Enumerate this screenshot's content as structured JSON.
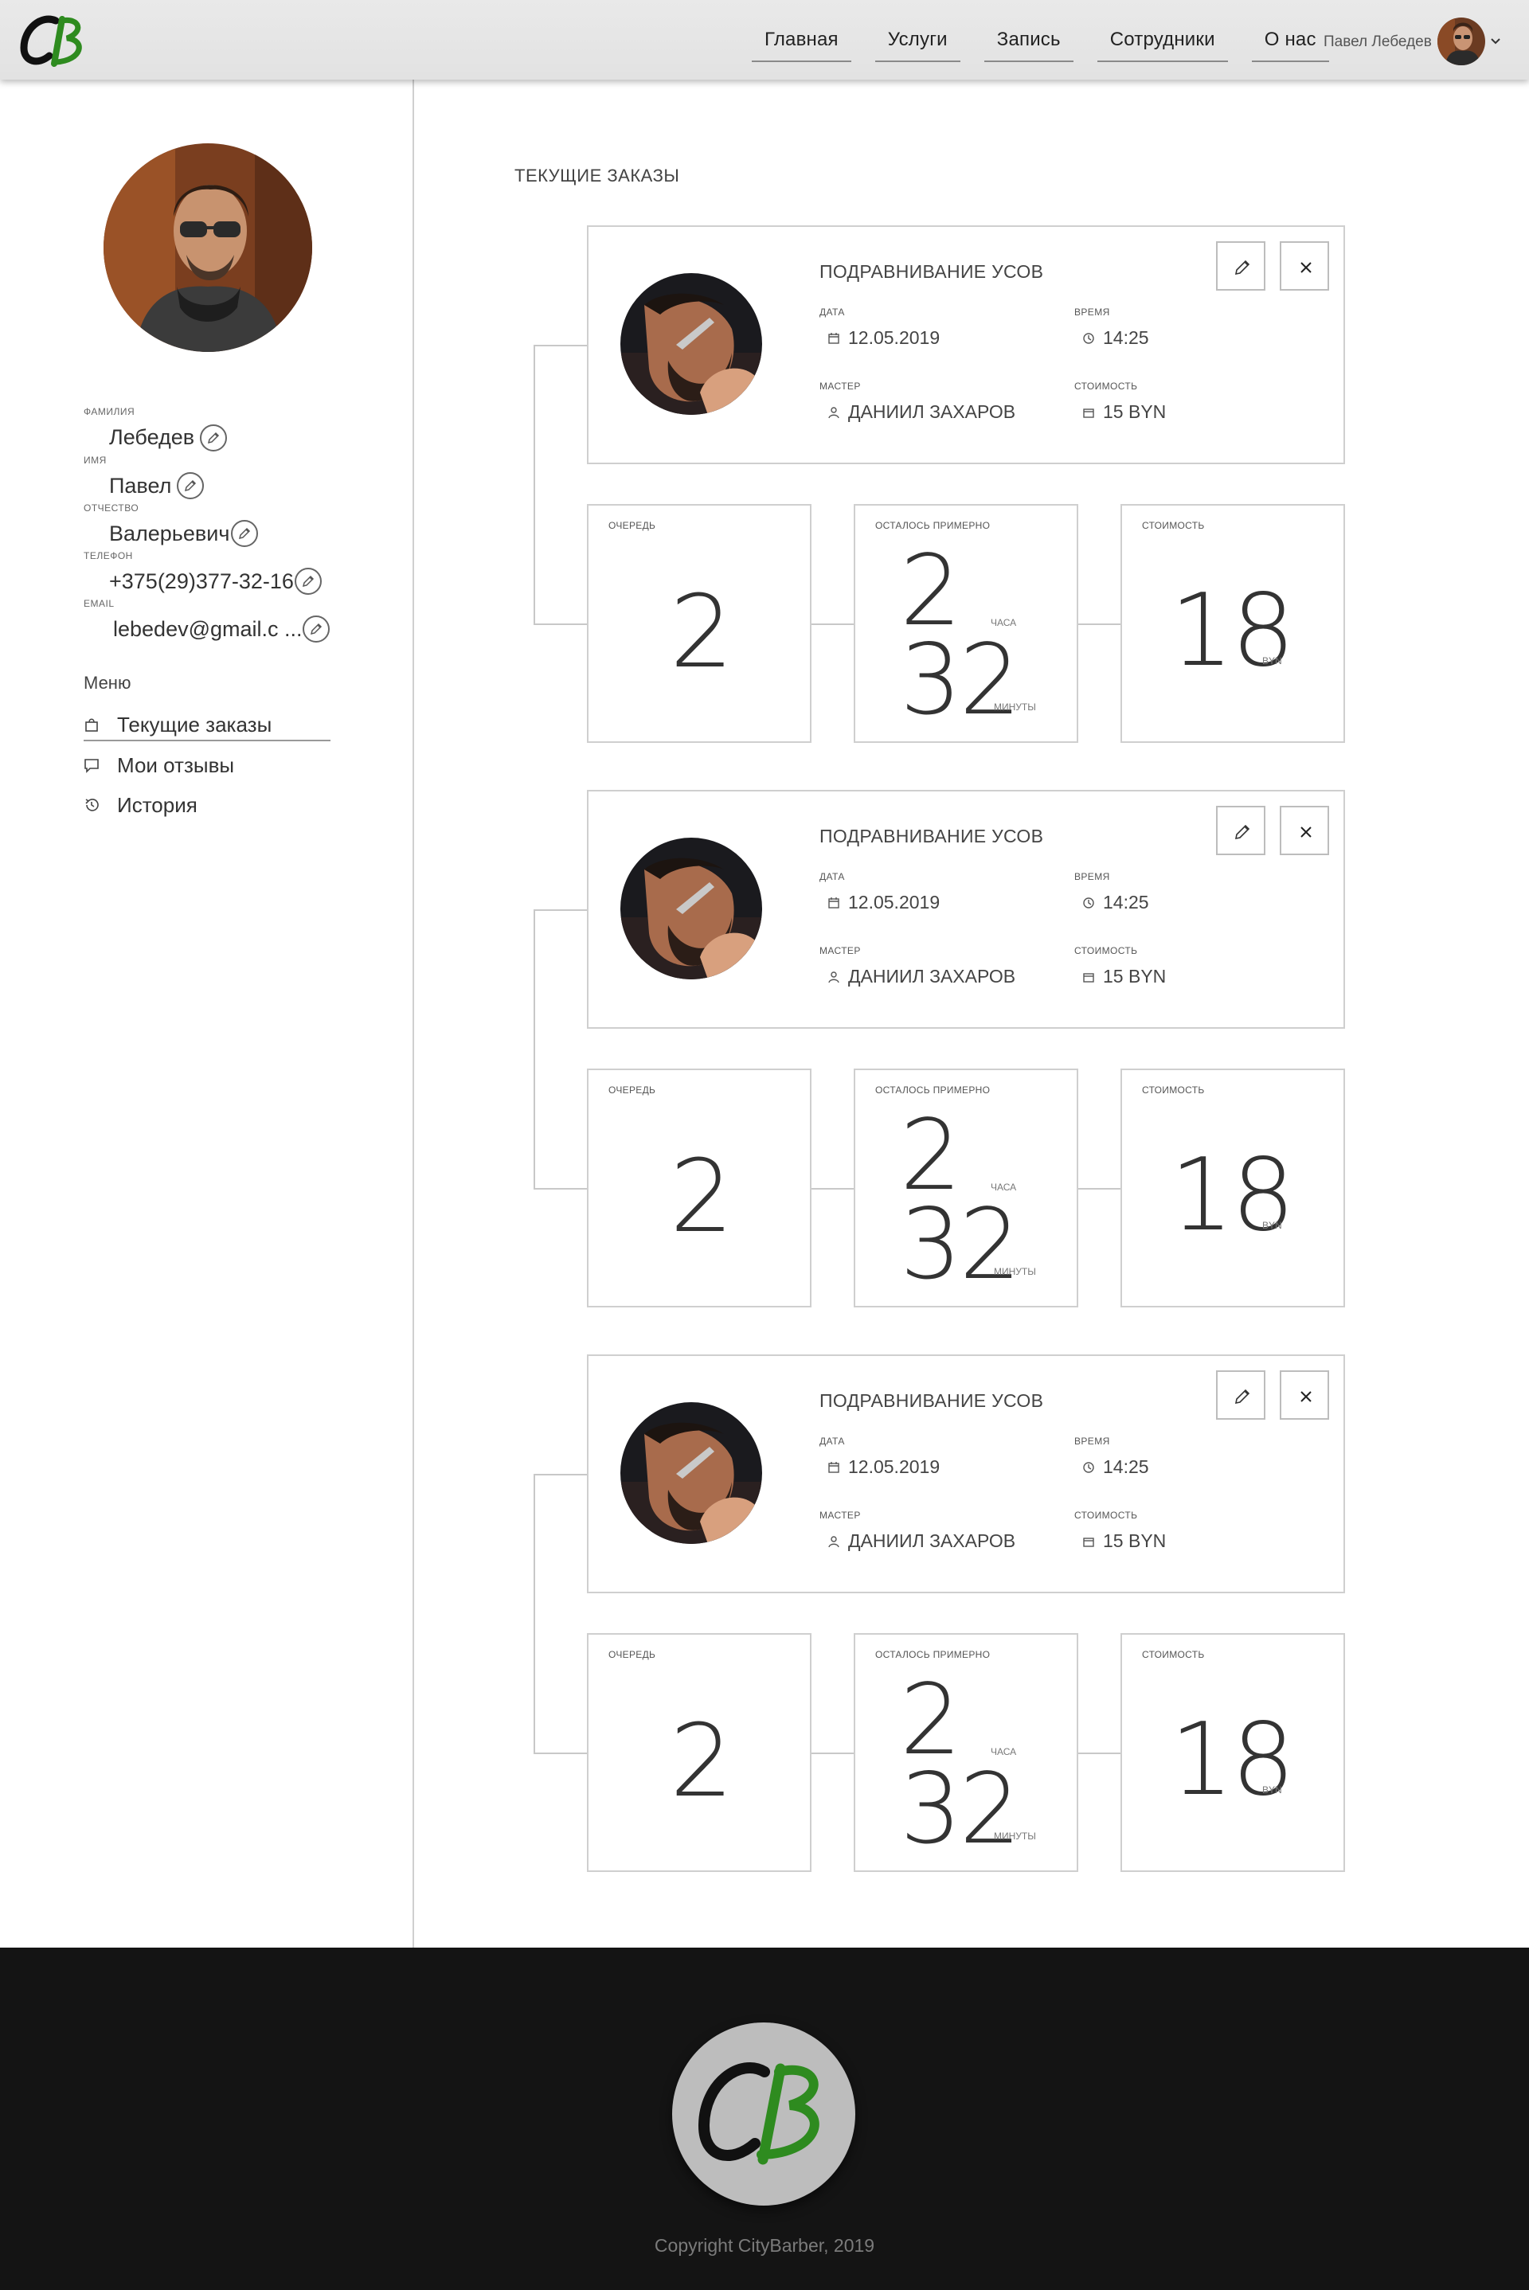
{
  "header": {
    "logo_text": "CB",
    "nav": [
      "Главная",
      "Услуги",
      "Запись",
      "Сотрудники",
      "О нас"
    ],
    "user_name": "Павел Лебедев"
  },
  "profile": {
    "fields": [
      {
        "label": "ФАМИЛИЯ",
        "value": "Лебедев"
      },
      {
        "label": "ИМЯ",
        "value": "Павел"
      },
      {
        "label": "ОТЧЕСТВО",
        "value": "Валерьевич"
      },
      {
        "label": "ТЕЛЕФОН",
        "value": "+375(29)377-32-16"
      },
      {
        "label": "EMAIL",
        "value": "lebedev@gmail.c ..."
      }
    ]
  },
  "menu": {
    "title": "Меню",
    "items": [
      {
        "label": "Текущие заказы",
        "icon": "bag-icon",
        "active": true
      },
      {
        "label": "Мои отзывы",
        "icon": "comment-icon",
        "active": false
      },
      {
        "label": "История",
        "icon": "history-icon",
        "active": false
      }
    ]
  },
  "main": {
    "title": "ТЕКУЩИЕ ЗАКАЗЫ",
    "orders": [
      {
        "service": "ПОДРАВНИВАНИЕ УСОВ",
        "date_label": "ДАТА",
        "date": "12.05.2019",
        "time_label": "ВРЕМЯ",
        "time": "14:25",
        "master_label": "МАСТЕР",
        "master": "ДАНИИЛ ЗАХАРОВ",
        "cost_label": "СТОИМОСТЬ",
        "cost": "15 BYN",
        "queue_label": "ОЧЕРЕДЬ",
        "queue": "2",
        "remaining_label": "ОСТАЛОСЬ ПРИМЕРНО",
        "hours": "2",
        "hours_unit": "ЧАСА",
        "minutes": "32",
        "minutes_unit": "МИНУТЫ",
        "price_label": "СТОИМОСТЬ",
        "price": "18",
        "price_unit": "BYN"
      },
      {
        "service": "ПОДРАВНИВАНИЕ УСОВ",
        "date_label": "ДАТА",
        "date": "12.05.2019",
        "time_label": "ВРЕМЯ",
        "time": "14:25",
        "master_label": "МАСТЕР",
        "master": "ДАНИИЛ ЗАХАРОВ",
        "cost_label": "СТОИМОСТЬ",
        "cost": "15 BYN",
        "queue_label": "ОЧЕРЕДЬ",
        "queue": "2",
        "remaining_label": "ОСТАЛОСЬ ПРИМЕРНО",
        "hours": "2",
        "hours_unit": "ЧАСА",
        "minutes": "32",
        "minutes_unit": "МИНУТЫ",
        "price_label": "СТОИМОСТЬ",
        "price": "18",
        "price_unit": "BYN"
      },
      {
        "service": "ПОДРАВНИВАНИЕ УСОВ",
        "date_label": "ДАТА",
        "date": "12.05.2019",
        "time_label": "ВРЕМЯ",
        "time": "14:25",
        "master_label": "МАСТЕР",
        "master": "ДАНИИЛ ЗАХАРОВ",
        "cost_label": "СТОИМОСТЬ",
        "cost": "15 BYN",
        "queue_label": "ОЧЕРЕДЬ",
        "queue": "2",
        "remaining_label": "ОСТАЛОСЬ ПРИМЕРНО",
        "hours": "2",
        "hours_unit": "ЧАСА",
        "minutes": "32",
        "minutes_unit": "МИНУТЫ",
        "price_label": "СТОИМОСТЬ",
        "price": "18",
        "price_unit": "BYN"
      }
    ]
  },
  "footer": {
    "logo_text": "CB",
    "copyright": "Copyright CityBarber, 2019"
  },
  "colors": {
    "brand_green": "#2e8b1f",
    "header_bg": "#e6e6e6",
    "footer_bg": "#141414"
  }
}
